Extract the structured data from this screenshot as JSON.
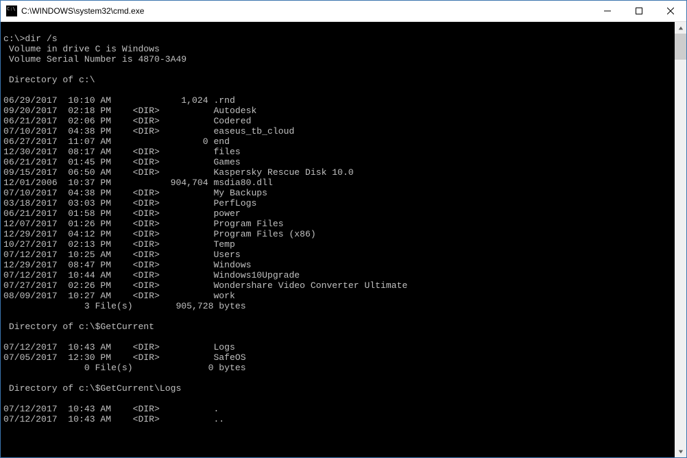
{
  "window": {
    "title": "C:\\WINDOWS\\system32\\cmd.exe"
  },
  "terminal": {
    "prompt_line": "c:\\>dir /s",
    "volume_line": " Volume in drive C is Windows",
    "serial_line": " Volume Serial Number is 4870-3A49",
    "dir1_header": " Directory of c:\\",
    "dir1_entries": [
      "06/29/2017  10:10 AM             1,024 .rnd",
      "09/20/2017  02:18 PM    <DIR>          Autodesk",
      "06/21/2017  02:06 PM    <DIR>          Codered",
      "07/10/2017  04:38 PM    <DIR>          easeus_tb_cloud",
      "06/27/2017  11:07 AM                 0 end",
      "12/30/2017  08:17 AM    <DIR>          files",
      "06/21/2017  01:45 PM    <DIR>          Games",
      "09/15/2017  06:50 AM    <DIR>          Kaspersky Rescue Disk 10.0",
      "12/01/2006  10:37 PM           904,704 msdia80.dll",
      "07/10/2017  04:38 PM    <DIR>          My Backups",
      "03/18/2017  03:03 PM    <DIR>          PerfLogs",
      "06/21/2017  01:58 PM    <DIR>          power",
      "12/07/2017  01:26 PM    <DIR>          Program Files",
      "12/29/2017  04:12 PM    <DIR>          Program Files (x86)",
      "10/27/2017  02:13 PM    <DIR>          Temp",
      "07/12/2017  10:25 AM    <DIR>          Users",
      "12/29/2017  08:47 PM    <DIR>          Windows",
      "07/12/2017  10:44 AM    <DIR>          Windows10Upgrade",
      "07/27/2017  02:26 PM    <DIR>          Wondershare Video Converter Ultimate",
      "08/09/2017  10:27 AM    <DIR>          work"
    ],
    "dir1_summary": "               3 File(s)        905,728 bytes",
    "dir2_header": " Directory of c:\\$GetCurrent",
    "dir2_entries": [
      "07/12/2017  10:43 AM    <DIR>          Logs",
      "07/05/2017  12:30 PM    <DIR>          SafeOS"
    ],
    "dir2_summary": "               0 File(s)              0 bytes",
    "dir3_header": " Directory of c:\\$GetCurrent\\Logs",
    "dir3_entries": [
      "07/12/2017  10:43 AM    <DIR>          .",
      "07/12/2017  10:43 AM    <DIR>          .."
    ]
  }
}
